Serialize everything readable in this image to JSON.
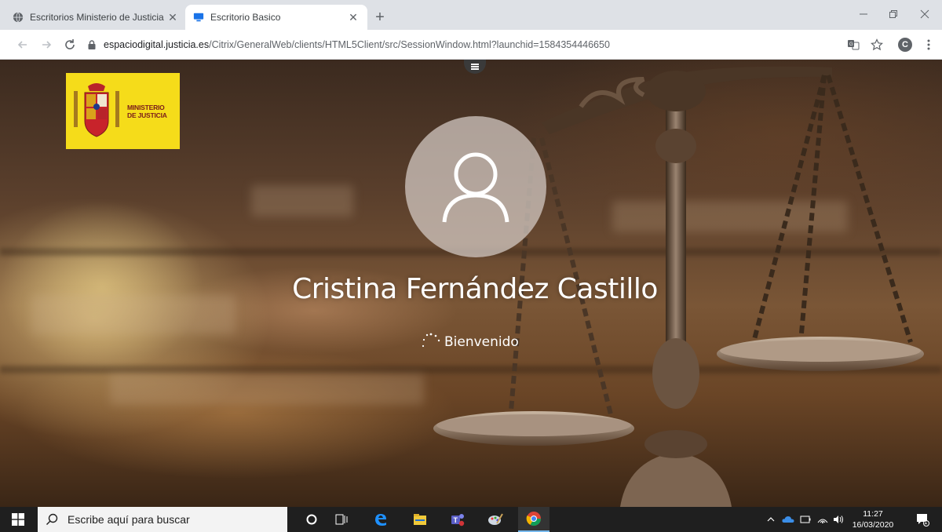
{
  "browser": {
    "tabs": [
      {
        "label": "Escritorios Ministerio de Justicia",
        "active": false
      },
      {
        "label": "Escritorio Basico",
        "active": true
      }
    ],
    "close_glyph": "✕",
    "new_tab_glyph": "+",
    "url_host": "espaciodigital.justicia.es",
    "url_path": "/Citrix/GeneralWeb/clients/HTML5Client/src/SessionWindow.html?launchid=1584354446650",
    "profile_initial": "C"
  },
  "logo": {
    "text_line1": "MINISTERIO",
    "text_line2": "DE JUSTICIA",
    "background": "#f5dc1a"
  },
  "login": {
    "user_name": "Cristina Fernández Castillo",
    "status": "Bienvenido"
  },
  "taskbar": {
    "search_placeholder": "Escribe aquí para buscar",
    "time": "11:27",
    "date": "16/03/2020",
    "notification_count": "1",
    "pinned": [
      "cortana-circle",
      "task-view",
      "edge",
      "file-explorer",
      "teams",
      "paint",
      "chrome"
    ]
  },
  "colors": {
    "accent_blue": "#0078d7",
    "taskbar": "#1f1f1f",
    "chrome_tabbar": "#dee1e6"
  }
}
